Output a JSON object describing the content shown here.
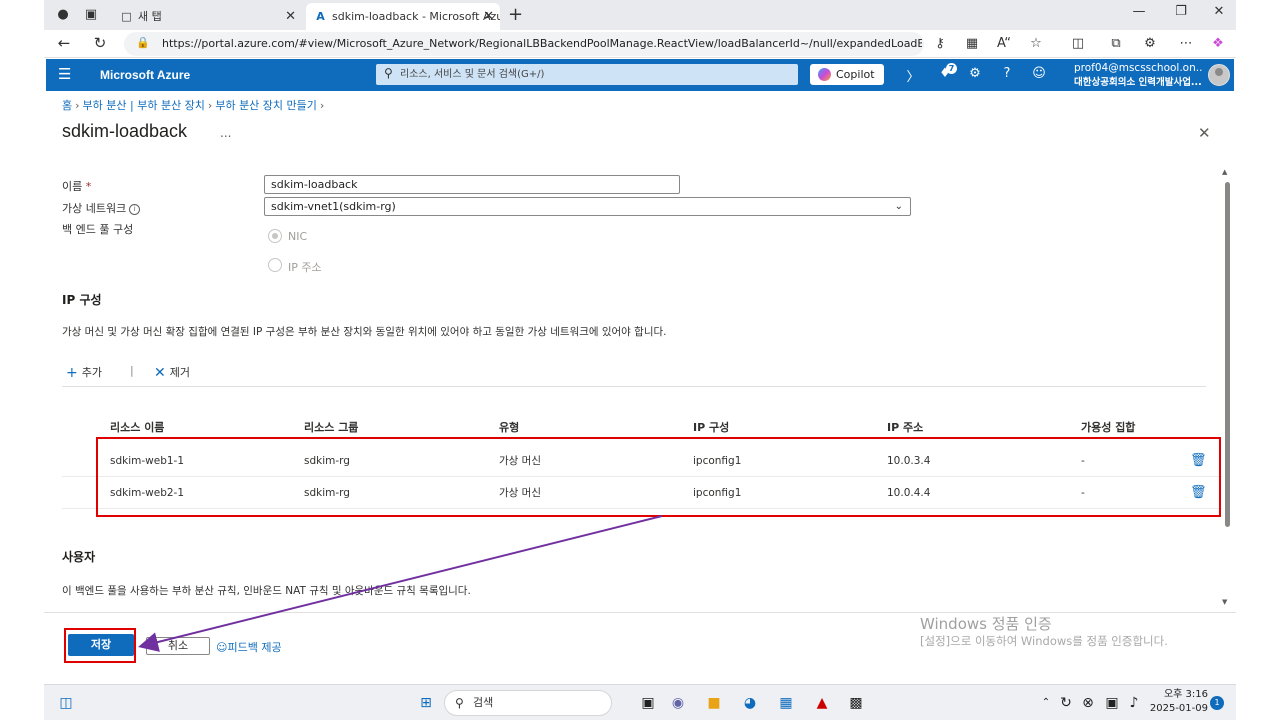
{
  "browser": {
    "tabs": [
      {
        "label": "새 탭"
      },
      {
        "label": "sdkim-loadback - Microsoft Azure"
      }
    ],
    "url": "https://portal.azure.com/#view/Microsoft_Azure_Network/RegionalLBBackendPoolManage.ReactView/loadBalancerId~/null/expandedLoadBalancer~/..."
  },
  "azure": {
    "brand": "Microsoft Azure",
    "search_placeholder": "리소스, 서비스 및 문서 검색(G+/)",
    "copilot_label": "Copilot",
    "notification_count": "7",
    "account_email": "prof04@mscsschool.on...",
    "account_org": "대한상공회의소 인력개발사업..."
  },
  "breadcrumb": [
    "홈",
    "부하 분산 | 부하 분산 장치",
    "부하 분산 장치 만들기"
  ],
  "page": {
    "title": "sdkim-loadback",
    "more": "...",
    "name_label": "이름",
    "name_required": "*",
    "name_value": "sdkim-loadback",
    "vnet_label": "가상 네트워크",
    "vnet_value": "sdkim-vnet1(sdkim-rg)",
    "pool_label": "백 엔드 풀 구성",
    "radio_nic": "NIC",
    "radio_ip": "IP 주소"
  },
  "ip_config": {
    "heading": "IP 구성",
    "description": "가상 머신 및 가상 머신 확장 집합에 연결된 IP 구성은 부하 분산 장치와 동일한 위치에 있어야 하고 동일한 가상 네트워크에 있어야 합니다.",
    "add_label": "추가",
    "remove_label": "제거",
    "columns": [
      "리소스 이름",
      "리소스 그룹",
      "유형",
      "IP 구성",
      "IP 주소",
      "가용성 집합"
    ],
    "rows": [
      [
        "sdkim-web1-1",
        "sdkim-rg",
        "가상 머신",
        "ipconfig1",
        "10.0.3.4",
        "-"
      ],
      [
        "sdkim-web2-1",
        "sdkim-rg",
        "가상 머신",
        "ipconfig1",
        "10.0.4.4",
        "-"
      ]
    ]
  },
  "users": {
    "heading": "사용자",
    "description": "이 백엔드 풀을 사용하는 부하 분산 규칙, 인바운드 NAT 규칙 및 아웃바운드 규칙 목록입니다."
  },
  "footer": {
    "save_label": "저장",
    "cancel_label": "취소",
    "feedback_label": "피드백 제공"
  },
  "watermark": {
    "line1": "Windows 정품 인증",
    "line2": "[설정]으로 이동하여 Windows를 정품 인증합니다."
  },
  "taskbar": {
    "search_label": "검색",
    "time": "오후 3:16",
    "date": "2025-01-09",
    "notification_count": "1"
  },
  "colors": {
    "azure_blue": "#0f6cbd",
    "annotation_red": "#e00000",
    "annotation_arrow": "#7030a0"
  }
}
